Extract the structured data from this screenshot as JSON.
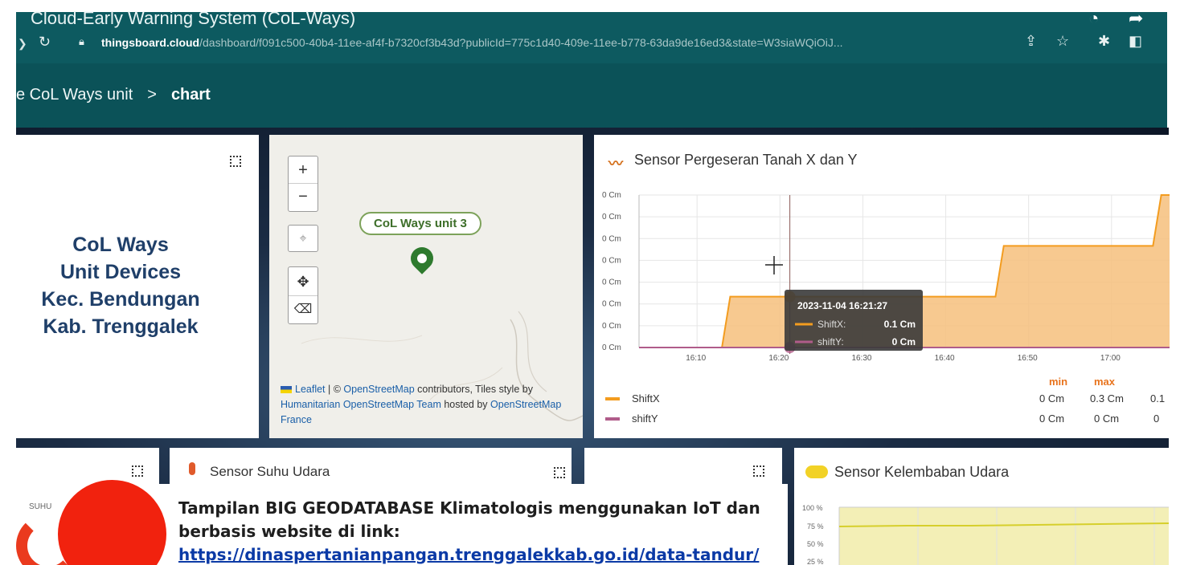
{
  "browser": {
    "window_title": "Cloud-Early Warning System (CoL-Ways)",
    "url_host": "thingsboard.cloud",
    "url_path": "/dashboard/f091c500-40b4-11ee-af4f-b7320cf3b43d?publicId=775c1d40-409e-11ee-b778-63da9de16ed3&state=W3siaWQiOiJ..."
  },
  "breadcrumb": {
    "parent": "e CoL Ways unit",
    "separator": ">",
    "current": "chart"
  },
  "device_card": {
    "title_lines": [
      "CoL Ways",
      "Unit Devices",
      "Kec. Bendungan",
      "Kab. Trenggalek"
    ]
  },
  "map": {
    "zoom_in": "+",
    "zoom_out": "−",
    "marker_label": "CoL Ways unit 3",
    "attribution": {
      "leaflet": "Leaflet",
      "sep1": " | © ",
      "osm": "OpenStreetMap",
      "txt1": " contributors, Tiles style by ",
      "hot": "Humanitarian OpenStreetMap Team",
      "txt2": " hosted by ",
      "osmfr": "OpenStreetMap France"
    }
  },
  "shift_chart": {
    "title": "Sensor Pergeseran Tanah X dan Y",
    "colors": {
      "shiftx": "#f39c1f",
      "shifty": "#b05c8a",
      "fill": "#f6c07d"
    },
    "tooltip": {
      "time": "2023-11-04 16:21:27",
      "rows": [
        {
          "name": "ShiftX:",
          "value": "0.1 Cm"
        },
        {
          "name": "shiftY:",
          "value": "0 Cm"
        }
      ]
    },
    "legend_headers": {
      "min": "min",
      "max": "max"
    },
    "legend": [
      {
        "name": "ShiftX",
        "min": "0 Cm",
        "max": "0.3 Cm",
        "extra": "0.1"
      },
      {
        "name": "shiftY",
        "min": "0 Cm",
        "max": "0 Cm",
        "extra": "0"
      }
    ]
  },
  "chart_data": {
    "type": "line",
    "title": "Sensor Pergeseran Tanah X dan Y",
    "y_tick_labels": [
      "0 Cm",
      "0 Cm",
      "0 Cm",
      "0 Cm",
      "0 Cm",
      "0 Cm",
      "0 Cm",
      "0 Cm"
    ],
    "x_tick_labels": [
      "16:10",
      "16:20",
      "16:30",
      "16:40",
      "16:50",
      "17:00"
    ],
    "ylim": [
      0,
      0.3
    ],
    "xlim": [
      "16:03",
      "17:07"
    ],
    "grid": true,
    "series": [
      {
        "name": "ShiftX",
        "x": [
          "16:03",
          "16:13",
          "16:14",
          "16:31",
          "16:32",
          "16:46",
          "16:47",
          "17:05",
          "17:06",
          "17:07"
        ],
        "values": [
          0,
          0,
          0.1,
          0.1,
          0.1,
          0.1,
          0.2,
          0.2,
          0.3,
          0.3
        ]
      },
      {
        "name": "shiftY",
        "x": [
          "16:03",
          "17:07"
        ],
        "values": [
          0,
          0
        ]
      }
    ]
  },
  "temp_card": {
    "title": "Sensor Suhu Udara",
    "gauge_label": "SUHU"
  },
  "humidity_card": {
    "title": "Sensor Kelembaban Udara",
    "y_tick_labels": [
      "100 %",
      "75 %",
      "50 %",
      "25 %"
    ]
  },
  "banner": {
    "line1": "Tampilan BIG GEODATABASE Klimatologis menggunakan IoT dan",
    "line2": "berbasis website di link:",
    "link": "https://dinaspertanianpangan.trenggalekkab.go.id/data-tandur/"
  }
}
